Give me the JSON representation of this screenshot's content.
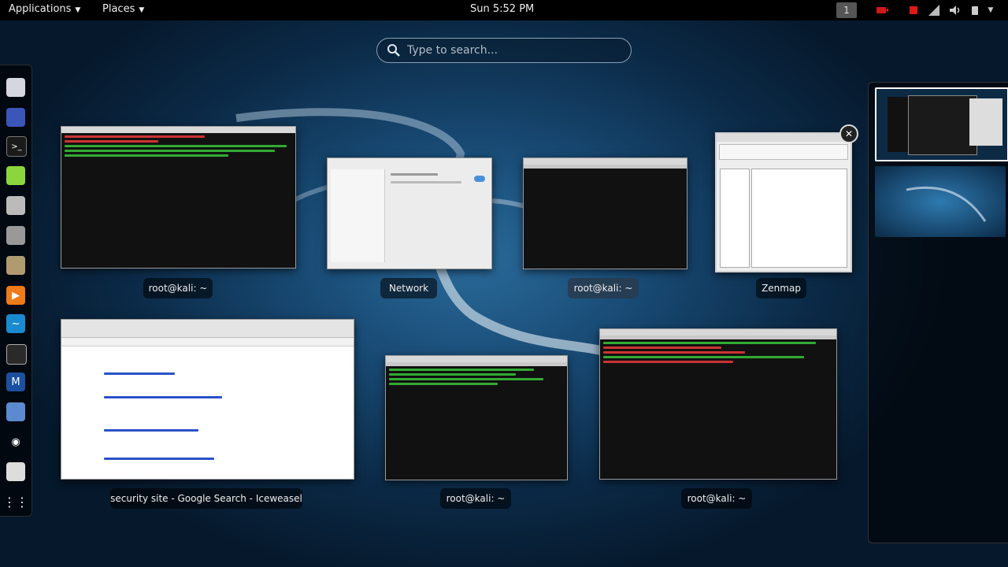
{
  "topbar": {
    "applications_label": "Applications",
    "places_label": "Places",
    "clock": "Sun  5:52 PM",
    "workspace_indicator": "1"
  },
  "search": {
    "placeholder": "Type to search..."
  },
  "dash_icons": [
    "database-icon",
    "app-icon",
    "terminal-icon",
    "green-app-icon",
    "file-icon",
    "wrench-icon",
    "package-icon",
    "media-player-icon",
    "wave-icon",
    "hook-icon",
    "shield-icon",
    "folder-icon",
    "eye-icon",
    "settings-icon",
    "show-apps-icon"
  ],
  "windows": [
    {
      "label": "root@kali: ~"
    },
    {
      "label": "Network"
    },
    {
      "label": "root@kali: ~"
    },
    {
      "label": "Zenmap"
    },
    {
      "label": "security site - Google Search - Iceweasel"
    },
    {
      "label": "root@kali: ~"
    },
    {
      "label": "root@kali: ~"
    }
  ],
  "colors": {
    "accent": "#ffffff",
    "panel_bg": "#000000",
    "terminal_bg": "#111111",
    "terminal_green": "#4fd34f",
    "terminal_red": "#e04040"
  }
}
